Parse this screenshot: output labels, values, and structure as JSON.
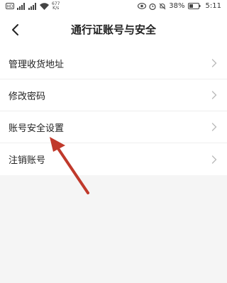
{
  "status_bar": {
    "net_speed_value": "677",
    "net_speed_unit": "K/s",
    "battery": "38%",
    "time": "5:11"
  },
  "nav": {
    "title": "通行证账号与安全"
  },
  "settings": {
    "items": [
      {
        "label": "管理收货地址"
      },
      {
        "label": "修改密码"
      },
      {
        "label": "账号安全设置"
      },
      {
        "label": "注销账号"
      }
    ]
  },
  "colors": {
    "annotation_arrow": "#c0392b",
    "background": "#f5f5f5",
    "chevron": "#b8b8b8"
  }
}
